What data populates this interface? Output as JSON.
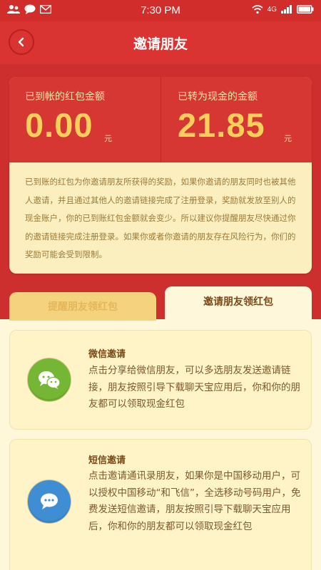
{
  "status_bar": {
    "time": "7:30 PM",
    "left_icons": [
      "contacts-icon",
      "chat-bubble-icon",
      "mail-icon"
    ],
    "right_icons": [
      "wifi-icon",
      "signal-icon",
      "battery-icon"
    ],
    "network_label": "4G"
  },
  "header": {
    "title": "邀请朋友",
    "back_icon": "chevron-left-icon"
  },
  "summary": {
    "received": {
      "label": "已到帐的红包金额",
      "value": "0.00",
      "unit": "元"
    },
    "converted": {
      "label": "已转为现金的金额",
      "value": "21.85",
      "unit": "元"
    },
    "description": "已到账的红包为你邀请朋友所获得的奖励，如果你邀请的朋友同时也被其他人邀请，并且通过其他人的邀请链接完成了注册登录，奖励就发放至别人的现金账户，你的已到账红包金额就会变少。所以建议你提醒朋友尽快通过你的邀请链接完成注册登录。如果你或者你邀请的朋友存在风险行为，你们的奖励可能会受到限制。"
  },
  "tabs": [
    {
      "label": "提醒朋友领红包",
      "active": false
    },
    {
      "label": "邀请朋友领红包",
      "active": true
    }
  ],
  "methods": [
    {
      "title": "微信邀请",
      "description": "点击分享给微信朋友，可以多选朋友发送邀请链接，朋友按照引导下载聊天宝应用后，你和你的朋友都可以领取现金红包",
      "icon": "wechat-icon"
    },
    {
      "title": "短信邀请",
      "description": "点击邀请通讯录朋友，如果你是中国移动用户，可以授权中国移动“和飞信”，全选移动号码用户，免费发送短信邀请，朋友按照引导下载聊天宝应用后，你和你的朋友都可以领取现金红包",
      "icon": "sms-bubble-icon"
    }
  ],
  "colors": {
    "primary_red": "#d93431",
    "gold": "#f7d05b",
    "cream": "#fff7d9",
    "wechat_green": "#75b734",
    "sms_blue": "#3f8ed3"
  }
}
